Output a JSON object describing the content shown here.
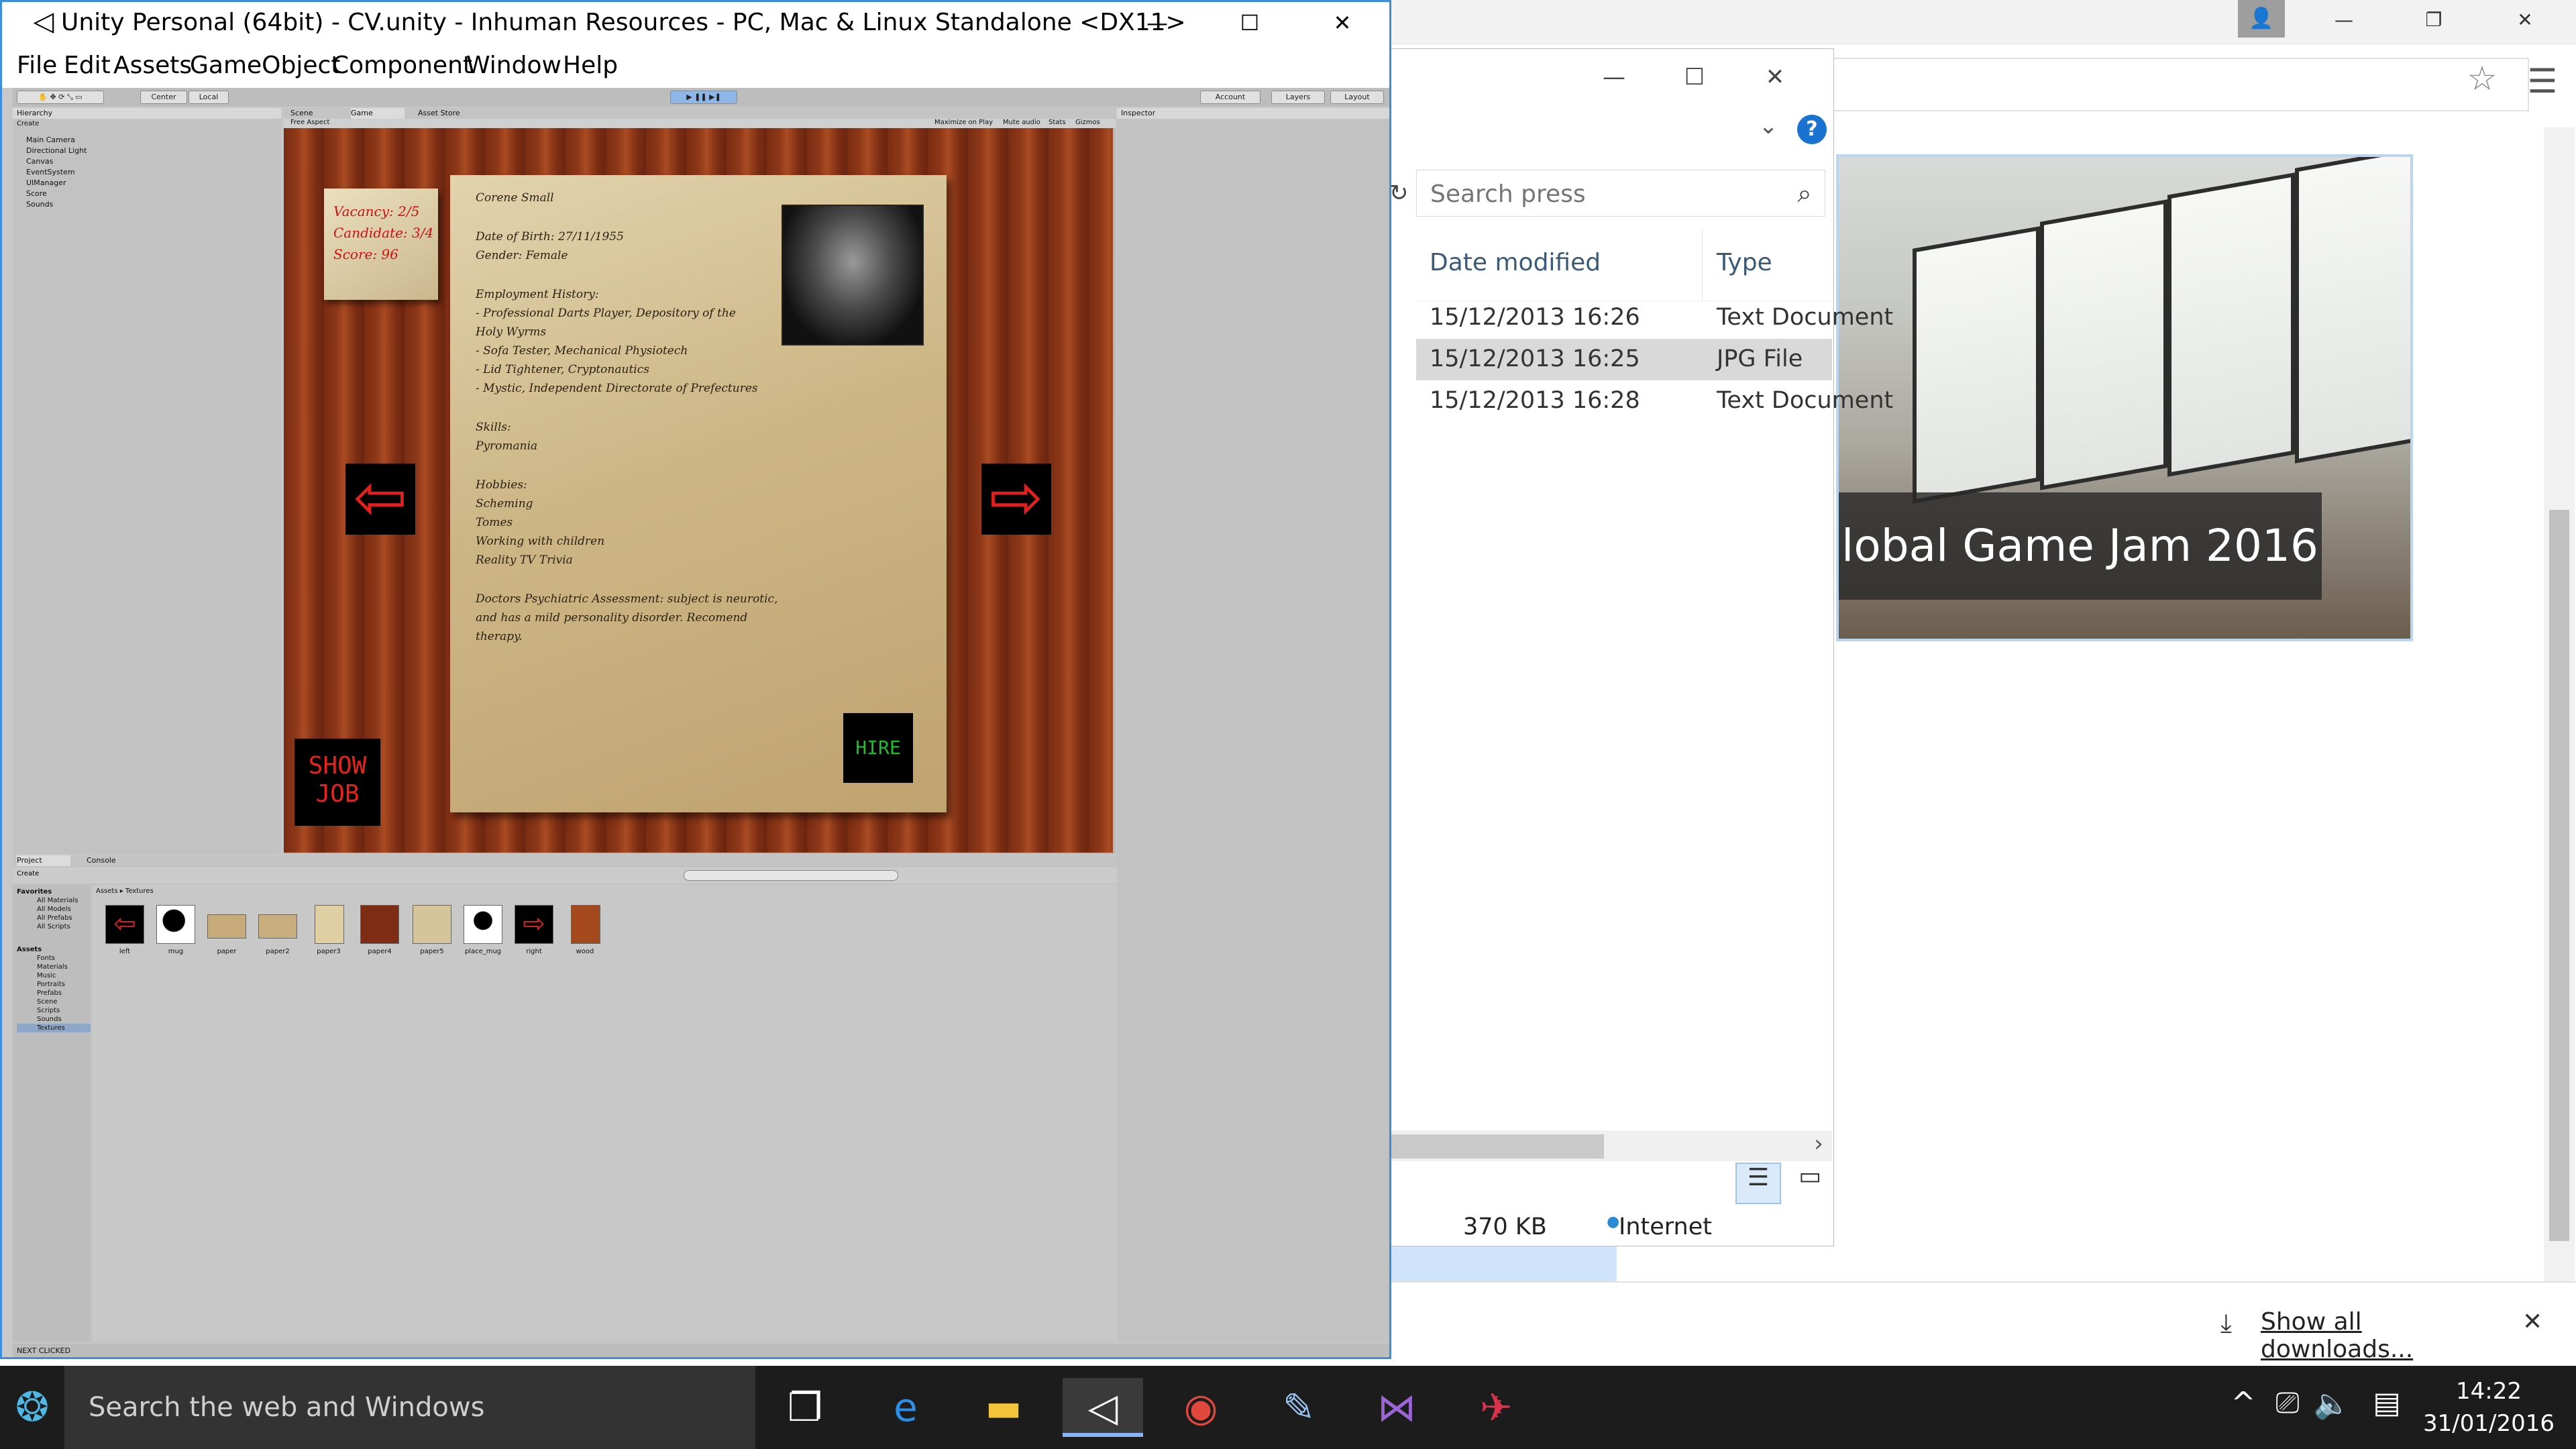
{
  "chrome": {
    "show_all_downloads": "Show all downloads...",
    "banner_text": "lobal Game Jam 2016",
    "icons": {
      "user": "user-icon",
      "star": "star-icon",
      "menu": "menu-icon",
      "download": "download-icon"
    }
  },
  "explorer": {
    "search_placeholder": "Search press",
    "columns": [
      "Date modified",
      "Type"
    ],
    "rows": [
      {
        "date": "15/12/2013 16:26",
        "type": "Text Document",
        "selected": false
      },
      {
        "date": "15/12/2013 16:25",
        "type": "JPG File",
        "selected": true
      },
      {
        "date": "15/12/2013 16:28",
        "type": "Text Document",
        "selected": false
      }
    ],
    "status_size": "370 KB",
    "status_zone": "Internet"
  },
  "unity": {
    "title": "Unity Personal (64bit) - CV.unity - Inhuman Resources - PC, Mac & Linux Standalone <DX11>",
    "menu": [
      "File",
      "Edit",
      "Assets",
      "GameObject",
      "Component",
      "Window",
      "Help"
    ],
    "toolbar": {
      "center": "Center",
      "local": "Local",
      "account": "Account",
      "layers": "Layers",
      "layout": "Layout"
    },
    "tabs": {
      "hierarchy": "Hierarchy",
      "scene": "Scene",
      "game": "Game",
      "asset_store": "Asset Store",
      "inspector": "Inspector",
      "project": "Project",
      "console": "Console"
    },
    "game_toolbar": {
      "aspect": "Free Aspect",
      "maximize": "Maximize on Play",
      "mute": "Mute audio",
      "stats": "Stats",
      "gizmos": "Gizmos"
    },
    "hierarchy": [
      "Main Camera",
      "Directional Light",
      "Canvas",
      "EventSystem",
      "UIManager",
      "Score",
      "Sounds"
    ],
    "game": {
      "note": [
        "Vacancy: 2/5",
        "Candidate: 3/4",
        "Score: 96"
      ],
      "cv": [
        "Corene Small",
        "",
        "Date of Birth: 27/11/1955",
        "Gender: Female",
        "",
        "Employment History:",
        "  - Professional Darts Player, Depository of the",
        "Holy Wyrms",
        "  - Sofa Tester, Mechanical Physiotech",
        "  - Lid Tightener, Cryptonautics",
        "  - Mystic, Independent Directorate of Prefectures",
        "",
        "Skills:",
        "Pyromania",
        "",
        "Hobbies:",
        "Scheming",
        "Tomes",
        "Working with children",
        "Reality TV Trivia",
        "",
        "Doctors Psychiatric Assessment: subject is neurotic,",
        "and has a mild personality disorder. Recomend",
        "therapy."
      ],
      "show_job": [
        "SHOW",
        "JOB"
      ],
      "hire": "HIRE",
      "left_arrow": "⇦",
      "right_arrow": "⇨"
    },
    "project": {
      "breadcrumb": "Assets ▸ Textures",
      "create": "Create",
      "favorites": [
        "Favorites",
        "All Materials",
        "All Models",
        "All Prefabs",
        "All Scripts"
      ],
      "assets_tree": [
        "Assets",
        "Fonts",
        "Materials",
        "Music",
        "Portraits",
        "Prefabs",
        "Scene",
        "Scripts",
        "Sounds",
        "Textures"
      ],
      "textures": [
        "left",
        "mug",
        "paper",
        "paper2",
        "paper3",
        "paper4",
        "paper5",
        "place_mug",
        "right",
        "wood"
      ]
    },
    "status": "NEXT CLICKED"
  },
  "taskbar": {
    "search": "Search the web and Windows",
    "time": "14:22",
    "date": "31/01/2016",
    "icons": [
      "task-view-icon",
      "edge-icon",
      "file-explorer-icon",
      "unity-icon",
      "chrome-icon",
      "paint-icon",
      "visual-studio-icon",
      "app-icon"
    ]
  }
}
